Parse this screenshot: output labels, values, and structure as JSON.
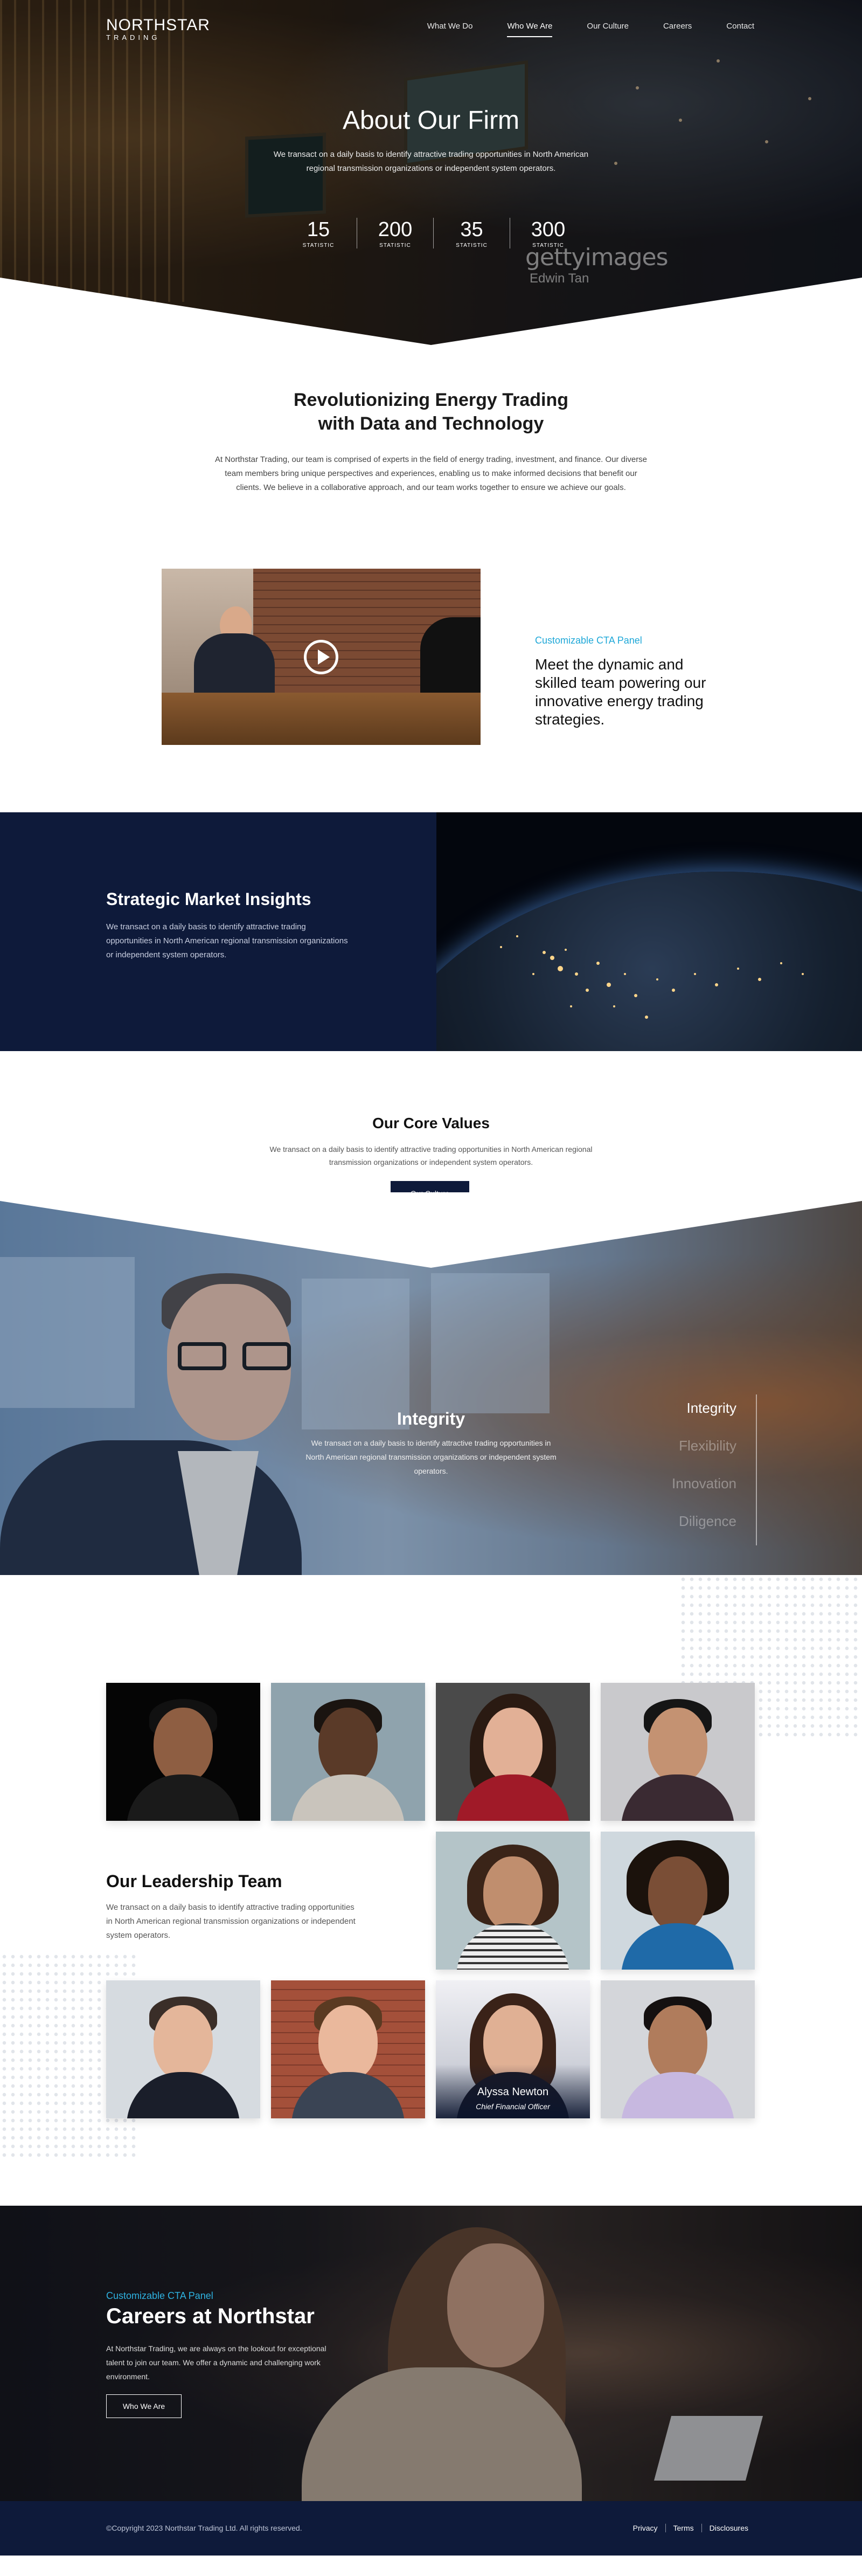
{
  "header": {
    "logo_name": "NORTHSTAR",
    "logo_sub": "TRADING",
    "nav": [
      {
        "label": "What We Do"
      },
      {
        "label": "Who We Are",
        "active": true
      },
      {
        "label": "Our Culture"
      },
      {
        "label": "Careers"
      },
      {
        "label": "Contact"
      }
    ]
  },
  "hero": {
    "title": "About Our Firm",
    "description": "We transact on a daily basis to identify attractive trading opportunities in North American regional transmission organizations or independent system operators.",
    "stats": [
      {
        "value": "15",
        "label": "STATISTIC"
      },
      {
        "value": "200",
        "label": "STATISTIC"
      },
      {
        "value": "35",
        "label": "STATISTIC"
      },
      {
        "value": "300",
        "label": "STATISTIC"
      }
    ],
    "watermark": "gettyimages",
    "watermark_credit": "Edwin Tan"
  },
  "intro": {
    "title_line1": "Revolutionizing Energy Trading",
    "title_line2": "with Data and Technology",
    "text": "At Northstar Trading, our team is comprised of experts in the field of energy trading, investment, and finance. Our diverse team members bring unique perspectives and experiences, enabling us to make informed decisions that benefit our clients. We believe in a collaborative approach, and our team works together to ensure we achieve our goals."
  },
  "video_cta": {
    "eyebrow": "Customizable CTA Panel",
    "text": "Meet the dynamic and skilled team powering our innovative energy trading strategies."
  },
  "strategic": {
    "title": "Strategic Market Insights",
    "text": "We transact on a daily basis to identify attractive trading opportunities in North American regional transmission organizations or independent system operators."
  },
  "core_values": {
    "title": "Our Core Values",
    "text": "We transact on a daily basis to identify attractive trading opportunities in North American regional transmission organizations or independent system operators.",
    "button": "Our Culture"
  },
  "integrity": {
    "title": "Integrity",
    "text": "We transact on a daily basis to identify attractive trading opportunities in North American regional transmission organizations or independent system operators.",
    "tabs": [
      {
        "label": "Integrity",
        "active": true
      },
      {
        "label": "Flexibility"
      },
      {
        "label": "Innovation"
      },
      {
        "label": "Diligence"
      }
    ]
  },
  "leadership": {
    "title": "Our Leadership Team",
    "text": "We transact on a daily basis to identify attractive trading opportunities in North American regional transmission organizations or independent system operators.",
    "featured_name": "Alyssa Newton",
    "featured_role": "Chief Financial Officer"
  },
  "careers": {
    "eyebrow": "Customizable CTA Panel",
    "title": "Careers at Northstar",
    "text": "At Northstar Trading, we are always on the lookout for exceptional talent to join our team. We offer a dynamic and challenging work environment.",
    "button": "Who We Are"
  },
  "footer": {
    "copyright": "©Copyright 2023 Northstar Trading Ltd. All rights reserved.",
    "links": [
      "Privacy",
      "Terms",
      "Disclosures"
    ]
  },
  "colors": {
    "navy": "#0e1a3a",
    "accent_blue": "#1fa8d8"
  }
}
